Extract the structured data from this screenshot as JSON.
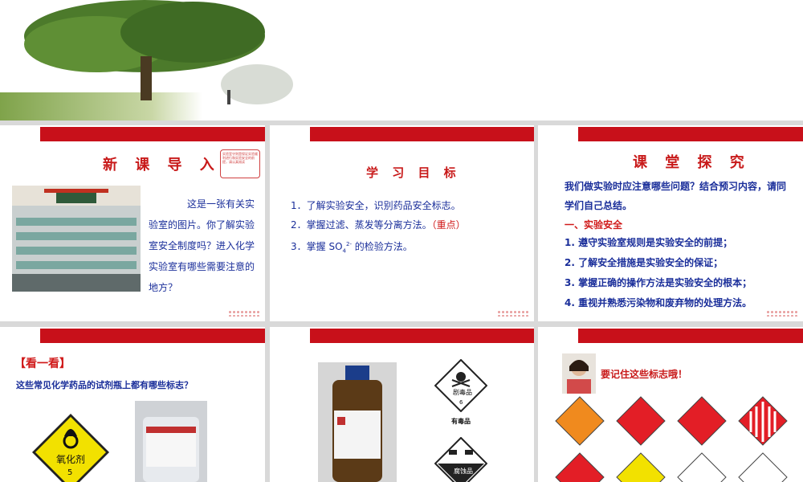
{
  "slide1": {
    "title": "新 课 导 入",
    "note": "实验室守则是保证实验顺利进行和实验安全的前提，请认真阅读",
    "body": "这是一张有关实验室的图片。你了解实验室安全制度吗？进入化学实验室有哪些需要注意的地方？"
  },
  "slide2": {
    "title": "学 习 目 标",
    "goals": [
      {
        "num": "1．",
        "text": "了解实验安全，识别药品安全标志。"
      },
      {
        "num": "2．",
        "text": "掌握过滤、蒸发等分离方法。",
        "tag": "（重点）"
      },
      {
        "num": "3．",
        "text_pre": "掌握 SO",
        "sub": "4",
        "sup": "2-",
        "text_post": " 的检验方法。"
      }
    ]
  },
  "slide3": {
    "title": "课 堂 探 究",
    "intro": "我们做实验时应注意哪些问题？结合预习内容，请同学们自己总结。",
    "section": "一、实验安全",
    "items": [
      "1. 遵守实验室规则是实验安全的前提；",
      "2. 了解安全措施是实验安全的保证；",
      "3. 掌握正确的操作方法是实验安全的根本；",
      "4. 重视并熟悉污染物和废弃物的处理方法。"
    ]
  },
  "slide4": {
    "heading": "【看一看】",
    "question": "这些常见化学药品的试剂瓶上都有哪些标志？",
    "sign_label": "氧化剂",
    "sign_num": "5"
  },
  "slide5": {
    "sign1_label": "剧毒品",
    "sign1_num": "6",
    "sign1_caption": "有毒品",
    "sign2_label": "腐蚀品"
  },
  "slide6": {
    "caption": "要记住这些标志哦！"
  },
  "colors": {
    "accent_red": "#c8101a",
    "text_blue": "#1a2e9a"
  }
}
